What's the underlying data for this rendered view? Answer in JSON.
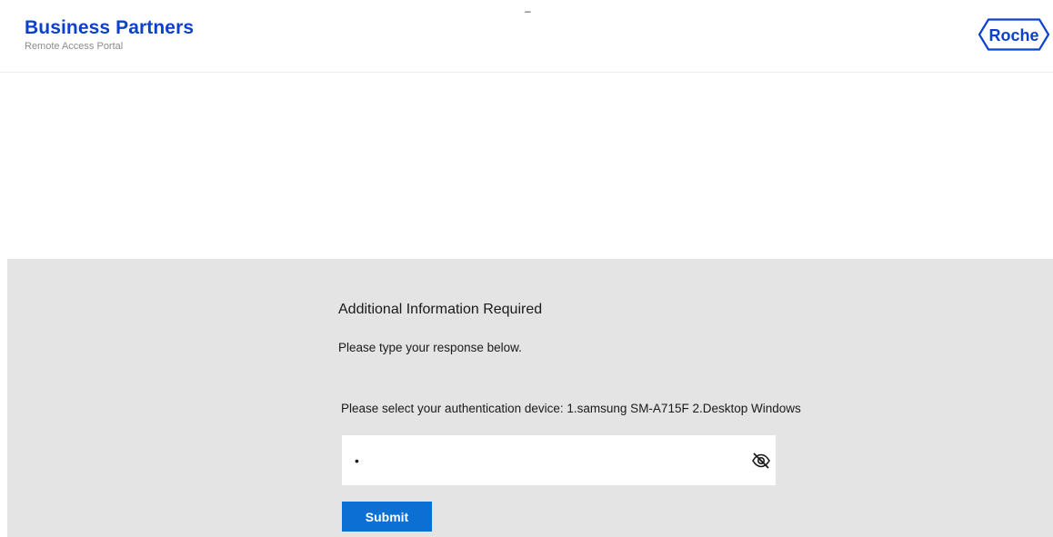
{
  "header": {
    "brand_title": "Business Partners",
    "brand_subtitle": "Remote Access Portal",
    "top_mark": "–",
    "logo_text": "Roche",
    "brand_color": "#0b41cd"
  },
  "form": {
    "title": "Additional Information Required",
    "instruction": "Please type your response below.",
    "prompt": "Please select your authentication device: 1.samsung SM-A715F 2.Desktop Windows",
    "response_value": "1",
    "toggle_icon": "eye-slash-icon",
    "submit_label": "Submit",
    "panel_color": "#e4e4e4",
    "button_color": "#0b6fd3"
  }
}
